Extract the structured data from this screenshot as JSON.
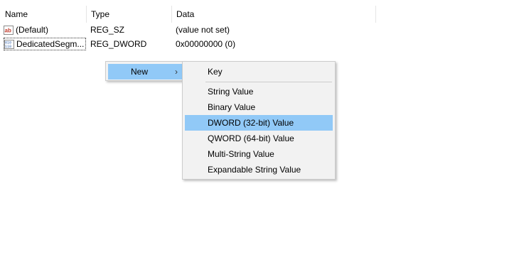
{
  "columns": {
    "name": "Name",
    "type": "Type",
    "data": "Data"
  },
  "rows": [
    {
      "icon": "string-value-icon",
      "name": "(Default)",
      "type": "REG_SZ",
      "data": "(value not set)"
    },
    {
      "icon": "binary-value-icon",
      "name": "DedicatedSegm...",
      "type": "REG_DWORD",
      "data": "0x00000000 (0)"
    }
  ],
  "context_menu": {
    "parent_item": {
      "label": "New",
      "arrow": "›"
    },
    "submenu_items": [
      {
        "label": "Key"
      },
      {
        "label": "String Value"
      },
      {
        "label": "Binary Value"
      },
      {
        "label": "DWORD (32-bit) Value",
        "highlighted": true
      },
      {
        "label": "QWORD (64-bit) Value"
      },
      {
        "label": "Multi-String Value"
      },
      {
        "label": "Expandable String Value"
      }
    ]
  },
  "colors": {
    "highlight": "#91c9f7",
    "menu_background": "#f2f2f2",
    "menu_border": "#cccccc",
    "string_icon_red": "#c0392b",
    "binary_icon_blue": "#2a5caa"
  }
}
